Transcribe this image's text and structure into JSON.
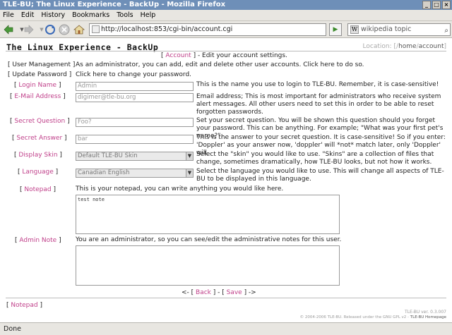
{
  "window": {
    "title": "TLE-BU; The Linux Experience - BackUp - Mozilla Firefox",
    "buttons": [
      "_",
      "□",
      "×"
    ]
  },
  "menu": [
    "File",
    "Edit",
    "History",
    "Bookmarks",
    "Tools",
    "Help"
  ],
  "nav": {
    "url": "http://localhost:853/cgi-bin/account.cgi",
    "search_value": "wikipedia topic",
    "icons": [
      "back-arrow-icon",
      "forward-arrow-icon",
      "reload-icon",
      "stop-icon",
      "home-icon"
    ]
  },
  "page": {
    "site_title": "The Linux Experience - BackUp",
    "location_prefix": "Location: [/",
    "location_home": "home",
    "location_sep": "/",
    "location_acct": "account",
    "location_suffix": "]",
    "account_link": "Account",
    "account_desc": "- Edit your account settings.",
    "user_mgmt_link": "User Management",
    "user_mgmt_desc": "As an administrator, you can add, edit and delete other user accounts. Click here to do so.",
    "update_pw_link": "Update Password",
    "update_pw_desc": "Click here to change your password.",
    "fields": {
      "login_name": {
        "label": "Login Name",
        "value": "Admin",
        "desc": "This is the name you use to login to TLE-BU. Remember, it is case-sensitive!"
      },
      "email": {
        "label": "E-Mail Address",
        "value": "digimer@tle-bu.org",
        "desc": "Email address; This is most important for administrators who receive system alert messages. All other users need to set this in order to be able to reset forgotten passwords."
      },
      "secret_q": {
        "label": "Secret Question",
        "value": "Foo?",
        "desc": "Set your secret question. You will be shown this question should you forget your password. This can be anything. For example; \"What was your first pet's name?\"."
      },
      "secret_a": {
        "label": "Secret Answer",
        "value": "bar",
        "desc": "This is the answer to your secret question. It is case-sensitive! So if you enter: 'Doppler' as your answer now, 'doppler' will *not* match later, only 'Doppler' will."
      },
      "skin": {
        "label": "Display Skin",
        "value": "Default TLE-BU Skin",
        "desc": "Select the \"skin\" you would like to use. \"Skins\" are a collection of files that change, sometimes dramatically, how TLE-BU looks, but not how it works."
      },
      "language": {
        "label": "Language",
        "value": "Canadian English",
        "desc": "Select the language you would like to use. This will change all aspects of TLE-BU to be displayed in this language."
      },
      "notepad": {
        "label": "Notepad",
        "desc": "This is your notepad, you can write anything you would like here.",
        "value": "test note"
      },
      "admin_note": {
        "label": "Admin Note",
        "desc": "You are an administrator, so you can see/edit the administrative notes for this user.",
        "value": ""
      }
    },
    "back_label": "Back",
    "save_label": "Save",
    "footer_notepad": "Notepad",
    "version": "TLE-BU ver. 0.3.007",
    "copyright": "© 2004-2006 TLE-BU. Released under the GNU GPL v2 -",
    "homepage_link": "TLE-BU Homepage"
  },
  "status": "Done"
}
